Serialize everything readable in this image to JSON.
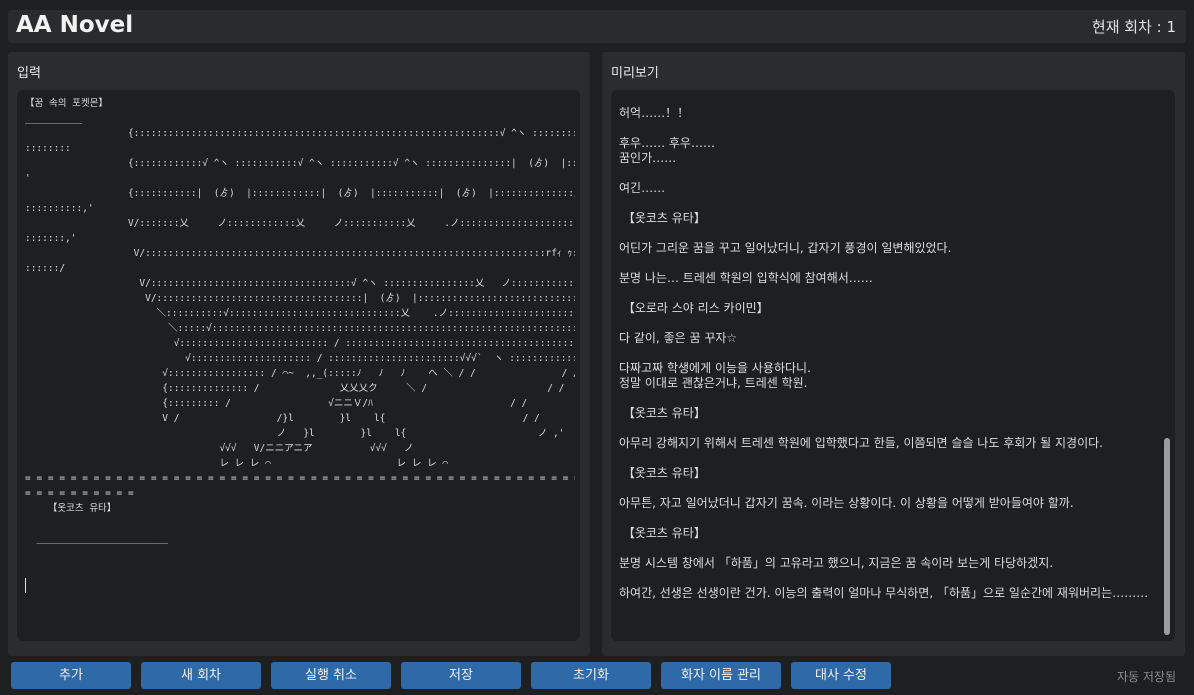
{
  "header": {
    "app_title": "AA Novel",
    "episode_label": "현재 회차 : 1"
  },
  "input_panel": {
    "label": "입력",
    "text": "【꿈 속의 포켓몬】\n__________\n                  {::::::::::::::::::::::::::::::::::::::::::::::::::::::::::::::::√ ^ヽ ::::::::::::::::::::::::::::::\n::::::::\n                  {::::::::::::√ ^ヽ :::::::::::√ ^ヽ :::::::::::√ ^ヽ :::::::::::::::|  (ゟ)  |::::::::::::::::::::::::::\n'\n                  {:::::::::::|  (ゟ)  |::::::::::::|  (ゟ)  |:::::::::::|  (ゟ)  |::::::::::::::乂    .ノ::::::::::::::::::::::\n::::::::::,'\n                  V/:::::::乂     ノ::::::::::::乂     ノ:::::::::::乂     .ノ:::::::::::::::::::::::::::::::::::::::::::\n:::::::,'\n                   V/::::::::::::::::::::::::::::::::::::::::::::::::::::::::::::::::::::::rfｨ ｩ::::::::::::::::::::::::::::::::\n::::::/\n                    V/:::::::::::::::::::::::::::::::::::√ ^ヽ ::::::::::::::::乂   ノ:::::::::::::::::::::::::::::::::::::: /\n                     V/::::::::::::::::::::::::::::::::::::|  (ゟ)  |::::::::::::::::::::::::::::::::::::::::::::::::::::: /\n                       ＼::::::::::√::::::::::::::::::::::::::::::乂    .ノ::::::::::::::::::::::::::::::::::::::::: /\n                         ＼:::::√::::::::::::::::::::::::::::::::::::::::::::::::::::::::::::::::::::::::::::::::: ＼\n                          √:::::::::::::::::::::::::: / :::::::::::::::::::::::::::::::::::::::::::::::::::::/:::::::::::::::: / ＼\n                            √::::::::::::::::::::: / :::::::::::::::::::::::√√√`  ヽ :::::::::::::: / / ~\"~    ＼＼\n                        √::::::::::::::::: / ⌒~  ,,_(:::::ﾉ   ﾉ   ﾉ    ヘ ＼ / /               / /\n                        {:::::::::::::: /              乂乂乂ク     ＼ /                     / /\n                        {::::::::: /                 √ニニＶ/ﾊ                        / /\n                        V /                 /}l        }l    l{                        / /\n                                            ノ   }l        }l    l{                       ノ ,'\n                                  √√√   V/ニニアニア          √√√   ノ\n                                  レ レ レ ⌒                      レ レ レ ⌒\n= = = = = = = = = = = = = = = = = = = = = = = = = = = = = = = = = = = = = = = = = = = = = = = = =\n= = = = = = = = = =\n    【옷코츠 유타】\n\n  _______________________"
  },
  "preview_panel": {
    "label": "미리보기",
    "paragraphs": [
      "허억……！！",
      "후우…… 후우……\n꿈인가……",
      "여긴……",
      " 【옷코츠 유타】",
      "어딘가 그리운 꿈을 꾸고 일어났더니, 갑자기 풍경이 일변해있었다.",
      "분명 나는… 트레센 학원의 입학식에 참여해서……",
      " 【오로라 스야 리스 카이민】",
      "다 같이, 좋은 꿈 꾸자☆",
      "다짜고짜 학생에게 이능을 사용하다니.\n정말 이대로 괜찮은거냐, 트레센 학원.",
      " 【옷코츠 유타】",
      "아무리 강해지기 위해서 트레센 학원에 입학했다고 한들, 이쯤되면 슬슬 나도 후회가 될 지경이다.",
      " 【옷코츠 유타】",
      "아무튼, 자고 일어났더니 갑자기 꿈속. 이라는 상황이다. 이 상황을 어떻게 받아들여야 할까.",
      " 【옷코츠 유타】",
      "분명 시스템 창에서 「하품」의 고유라고 했으니, 지금은 꿈 속이라 보는게 타당하겠지.",
      "하여간, 선생은 선생이란 건가. 이능의 출력이 얼마나 무식하면, 「하품」으로 일순간에 재워버리는………"
    ]
  },
  "toolbar": {
    "add": "추가",
    "new_episode": "새 회차",
    "undo": "실행 취소",
    "save": "저장",
    "reset": "초기화",
    "speaker_manage": "화자 이름 관리",
    "edit_dialogue": "대사 수정",
    "autosave_status": "자동 저장됨"
  },
  "colors": {
    "background": "#1e1f21",
    "panel": "#2b2c2e",
    "button": "#2f6aa8",
    "scroll_thumb": "#9c9c9c"
  }
}
